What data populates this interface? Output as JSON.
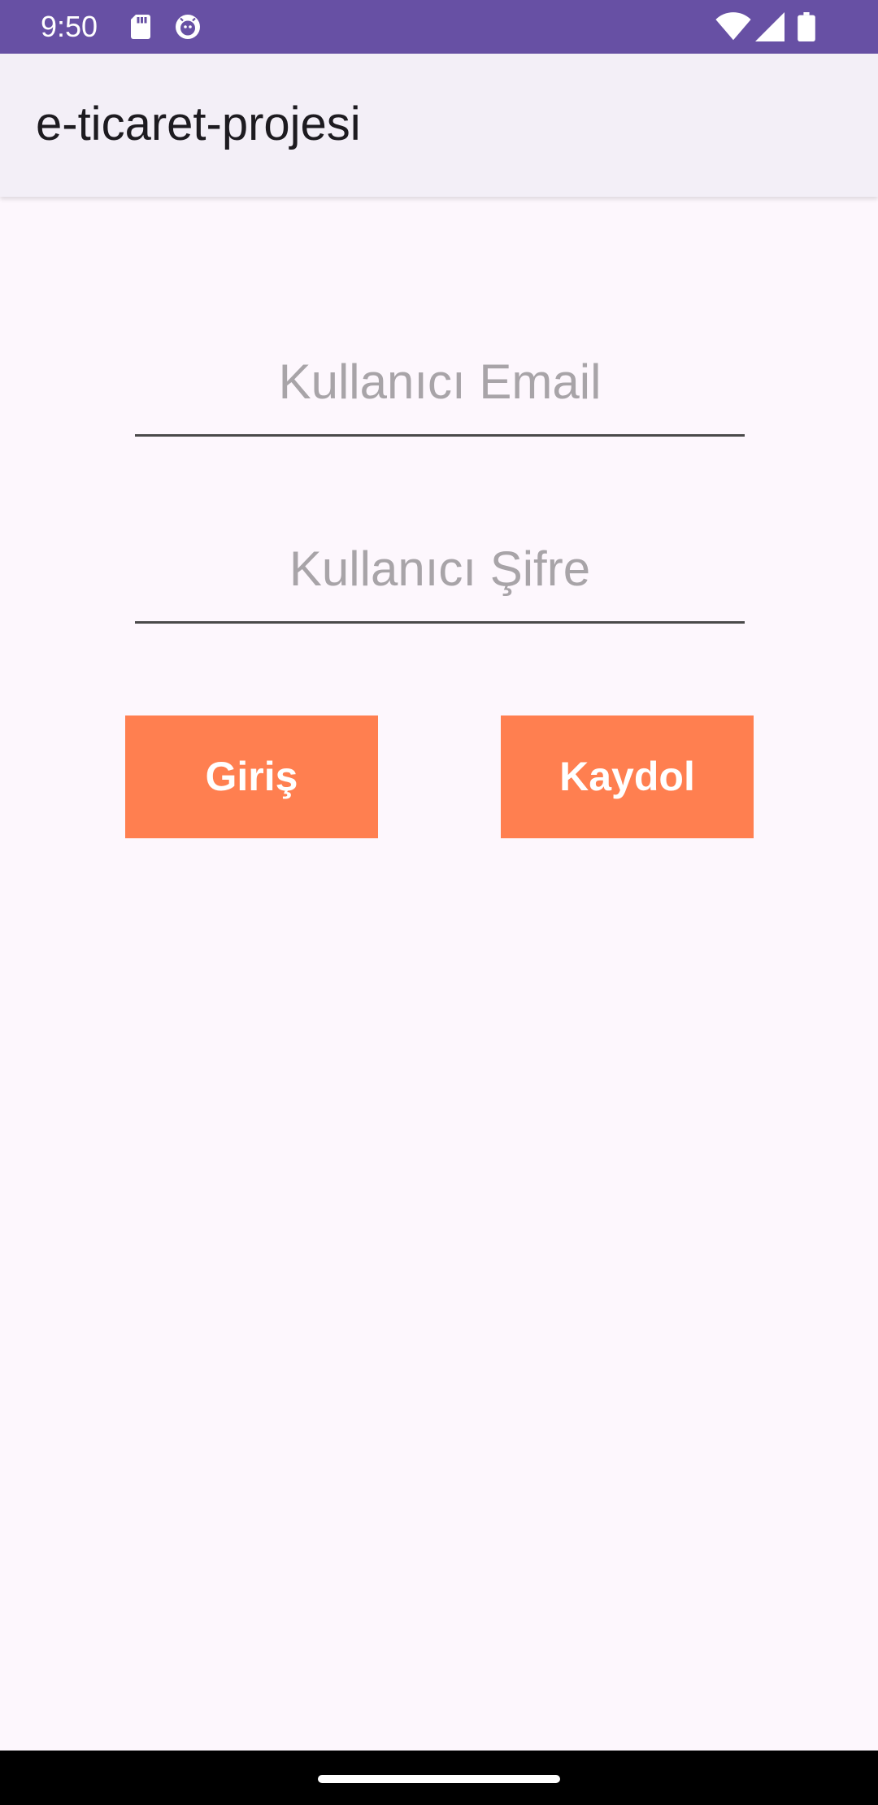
{
  "status_bar": {
    "time": "9:50",
    "icons": [
      "sd-card-icon",
      "android-debug-icon",
      "wifi-icon",
      "signal-icon",
      "battery-icon"
    ],
    "color": "#6750a4"
  },
  "app_bar": {
    "title": "e-ticaret-projesi"
  },
  "form": {
    "email": {
      "value": "",
      "placeholder": "Kullanıcı Email"
    },
    "password": {
      "value": "",
      "placeholder": "Kullanıcı Şifre"
    },
    "login_label": "Giriş",
    "register_label": "Kaydol"
  },
  "colors": {
    "accent": "#ff7f50",
    "background": "#fdf7fd",
    "app_bar": "#f3eff7"
  }
}
